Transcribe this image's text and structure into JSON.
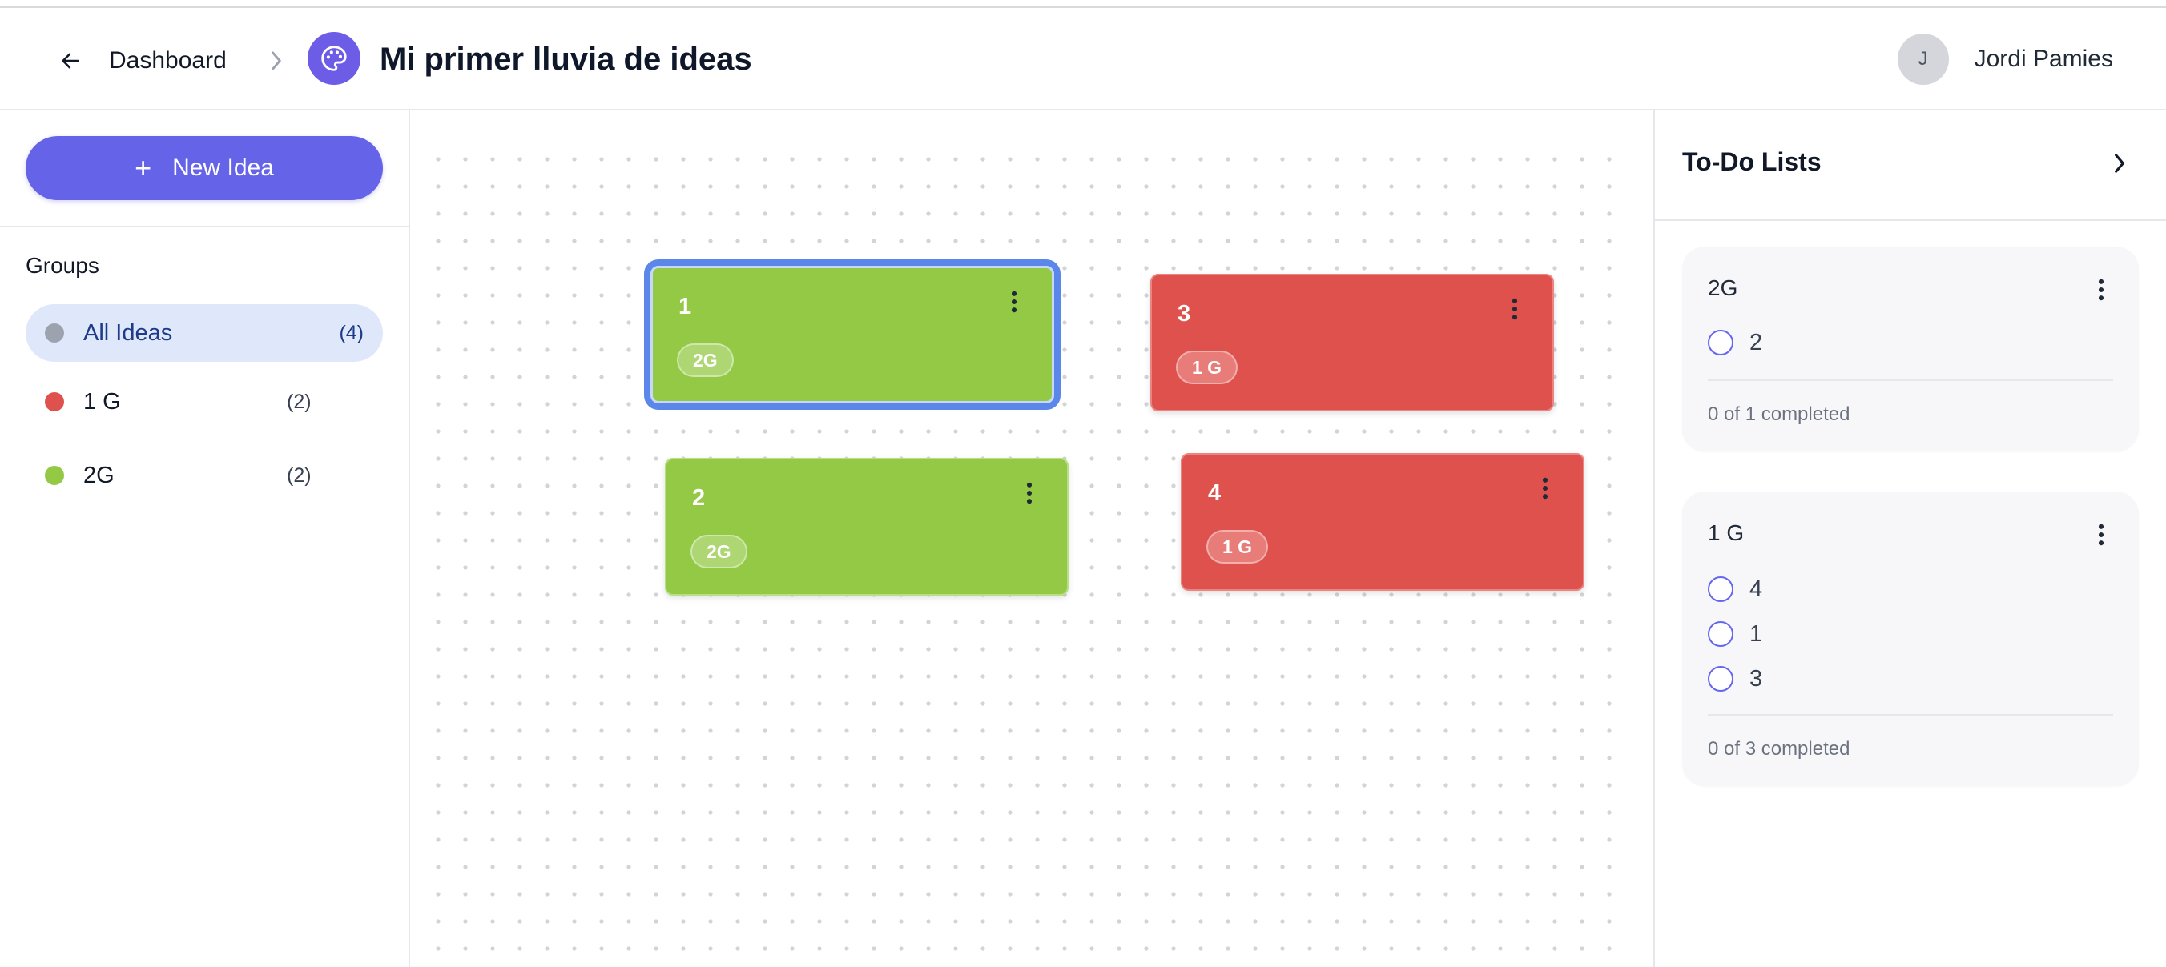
{
  "header": {
    "back_label": "Dashboard",
    "title": "Mi primer lluvia de ideas",
    "app_icon": "palette-icon",
    "user": {
      "initial": "J",
      "name": "Jordi Pamies"
    }
  },
  "sidebar": {
    "new_idea_label": "New Idea",
    "groups_title": "Groups",
    "groups": [
      {
        "label": "All Ideas",
        "count": "(4)",
        "color": "#9ca3af",
        "active": true
      },
      {
        "label": "1 G",
        "count": "(2)",
        "color": "#df514d",
        "active": false
      },
      {
        "label": "2G",
        "count": "(2)",
        "color": "#93c944",
        "active": false
      }
    ]
  },
  "canvas": {
    "cards": [
      {
        "title": "1",
        "tag": "2G",
        "color": "green",
        "selected": true
      },
      {
        "title": "3",
        "tag": "1 G",
        "color": "red",
        "selected": false
      },
      {
        "title": "2",
        "tag": "2G",
        "color": "green",
        "selected": false
      },
      {
        "title": "4",
        "tag": "1 G",
        "color": "red",
        "selected": false
      }
    ]
  },
  "todo_panel": {
    "title": "To-Do Lists",
    "lists": [
      {
        "title": "2G",
        "items": [
          "2"
        ],
        "footer": "0 of 1 completed"
      },
      {
        "title": "1 G",
        "items": [
          "4",
          "1",
          "3"
        ],
        "footer": "0 of 3 completed"
      }
    ]
  },
  "colors": {
    "accent": "#6563e8",
    "green": "#93c944",
    "red": "#df514d",
    "selection": "#5b86ea"
  }
}
